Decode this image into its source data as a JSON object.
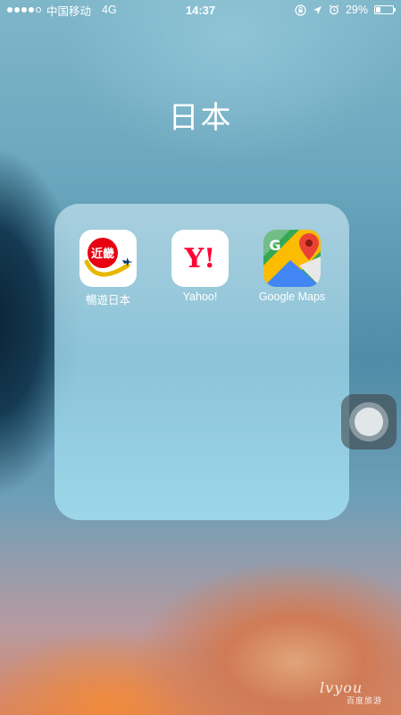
{
  "status_bar": {
    "carrier": "中国移动",
    "network": "4G",
    "time": "14:37",
    "battery": "29%",
    "battery_level": 0.29,
    "icons": [
      "orientation-lock-icon",
      "location-arrow-icon",
      "alarm-icon",
      "battery-icon"
    ]
  },
  "folder": {
    "title": "日本",
    "apps": [
      {
        "label": "暢遊日本",
        "icon": "kintetsu-app-icon",
        "badge_text": "近畿"
      },
      {
        "label": "Yahoo!",
        "icon": "yahoo-app-icon",
        "logo_text": "Y!"
      },
      {
        "label": "Google Maps",
        "icon": "google-maps-app-icon",
        "logo_text": "G"
      }
    ]
  },
  "watermark": {
    "brand": "lvyou",
    "sub": "百度旅游"
  },
  "colors": {
    "folder_bg": "#a8d8e8",
    "yahoo_red": "#ff0033",
    "kintetsu_red": "#e60012",
    "maps_green": "#34a853",
    "maps_blue": "#4285f4",
    "maps_yellow": "#fbbc04",
    "maps_red": "#ea4335"
  }
}
